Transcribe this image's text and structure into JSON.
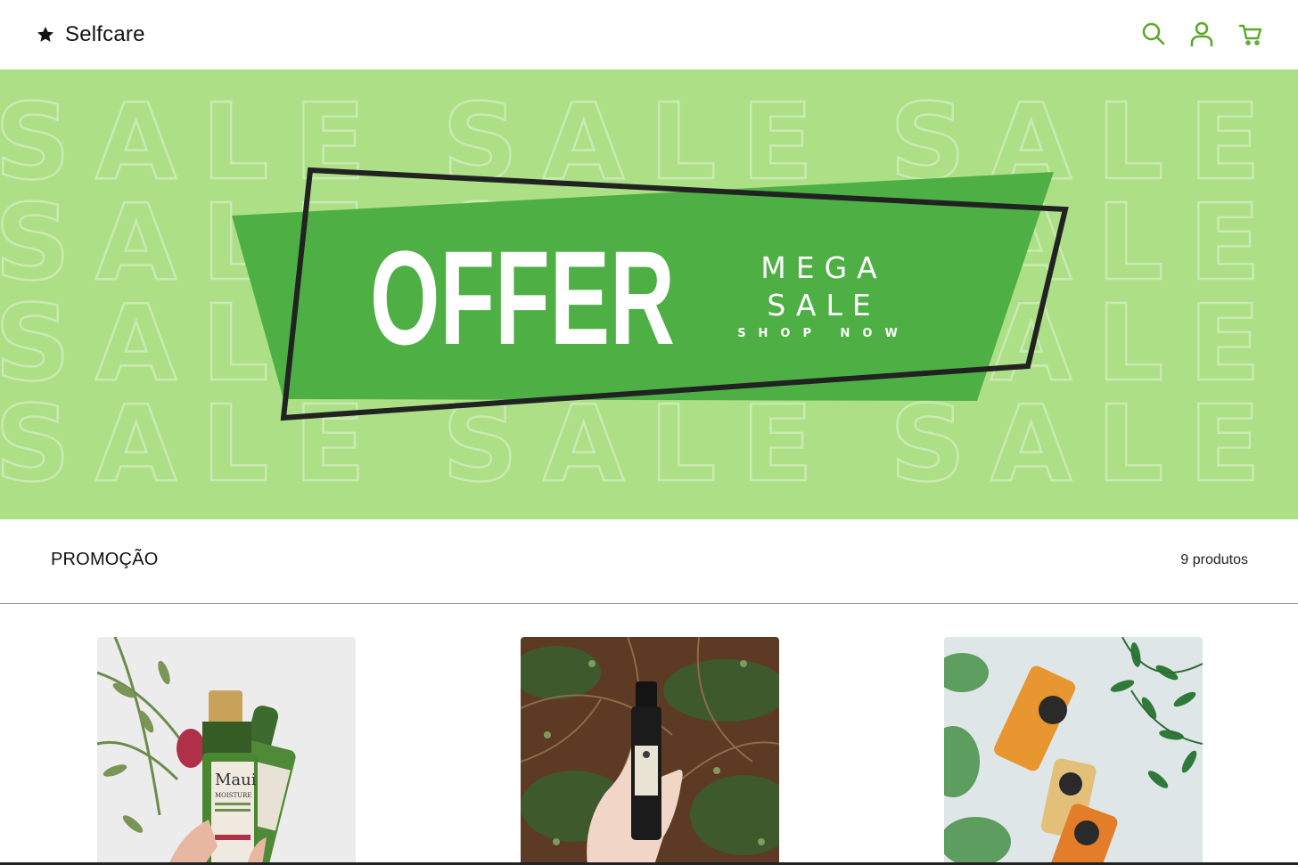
{
  "header": {
    "brand_icon": "star-icon",
    "brand_name": "Selfcare",
    "accent_color": "#5aaa2a",
    "icons": [
      "search-icon",
      "user-icon",
      "cart-icon"
    ]
  },
  "banner": {
    "background_word": "SALE",
    "headline": "OFFER",
    "line1": "MEGA",
    "line2": "SALE",
    "cta": "SHOP NOW",
    "background_color": "#addf86",
    "panel_color": "#4eb044"
  },
  "section": {
    "title": "PROMOÇÃO",
    "count": "9 produtos"
  },
  "products": [
    {
      "image": "green shampoo bottles product photo"
    },
    {
      "image": "serum dropper bottle in hand product photo"
    },
    {
      "image": "juice bottles with plant product photo"
    }
  ]
}
